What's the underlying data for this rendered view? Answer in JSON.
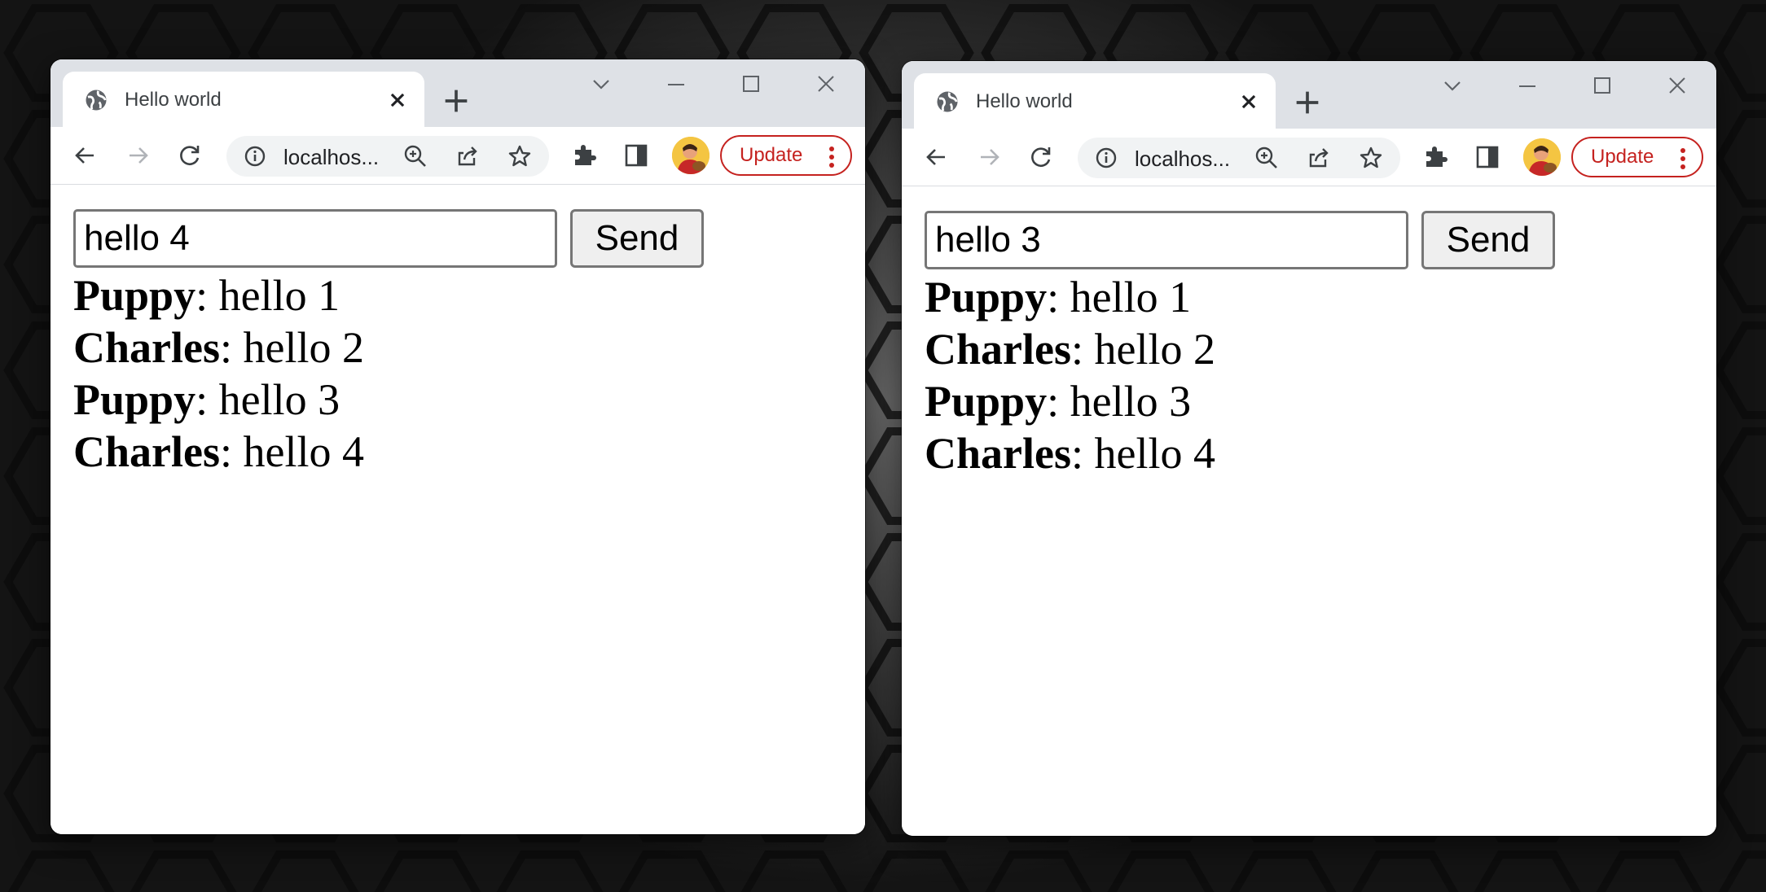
{
  "windows": [
    {
      "id": "left",
      "tab_title": "Hello world",
      "url": "localhos...",
      "update_label": "Update",
      "input_value": "hello 4",
      "send_label": "Send",
      "messages": [
        {
          "author": "Puppy",
          "text": ": hello 1"
        },
        {
          "author": "Charles",
          "text": ": hello 2"
        },
        {
          "author": "Puppy",
          "text": ": hello 3"
        },
        {
          "author": "Charles",
          "text": ": hello 4"
        }
      ]
    },
    {
      "id": "right",
      "tab_title": "Hello world",
      "url": "localhos...",
      "update_label": "Update",
      "input_value": "hello 3",
      "send_label": "Send",
      "messages": [
        {
          "author": "Puppy",
          "text": ": hello 1"
        },
        {
          "author": "Charles",
          "text": ": hello 2"
        },
        {
          "author": "Puppy",
          "text": ": hello 3"
        },
        {
          "author": "Charles",
          "text": ": hello 4"
        }
      ]
    }
  ],
  "colors": {
    "tabstrip": "#dee1e6",
    "omnibox": "#f1f3f4",
    "update_accent": "#c5221f"
  }
}
